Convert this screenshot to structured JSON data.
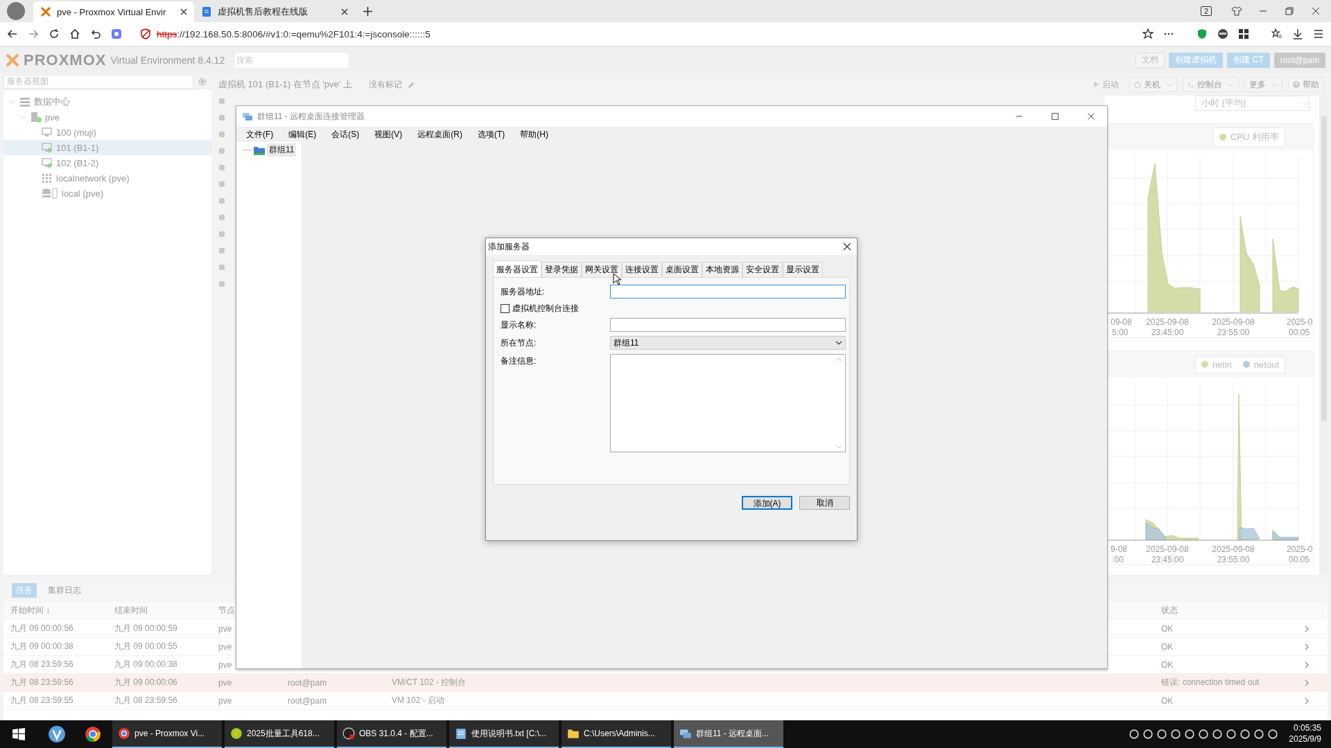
{
  "browser": {
    "tabs": [
      {
        "title": "pve - Proxmox Virtual Envir",
        "kind": "proxmox",
        "selected": true
      },
      {
        "title": "虚拟机售后教程在线版",
        "kind": "doc",
        "selected": false
      }
    ],
    "tab_count": "2",
    "url": {
      "scheme": "https",
      "rest": "://192.168.50.5:8006/#v1:0:=qemu%2F101:4:=jsconsole::::::5",
      "insecure": true
    }
  },
  "pve": {
    "logo": "PROXMOX",
    "product": "Virtual Environment 8.4.12",
    "search_placeholder": "搜索",
    "header_buttons": [
      {
        "label": "文档",
        "kind": "plain"
      },
      {
        "label": "创建虚拟机",
        "kind": "primary"
      },
      {
        "label": "创建 CT",
        "kind": "primary"
      }
    ],
    "user": "root@pam",
    "view_select": "服务器视图",
    "tree": [
      {
        "label": "数据中心",
        "kind": "datacenter",
        "expanded": true,
        "selected": false,
        "children": [
          {
            "label": "pve",
            "kind": "node",
            "expanded": true,
            "selected": false,
            "children": [
              {
                "label": "100 (muji)",
                "kind": "vm",
                "running": false,
                "selected": false
              },
              {
                "label": "101 (B1-1)",
                "kind": "vm",
                "running": true,
                "selected": true
              },
              {
                "label": "102 (B1-2)",
                "kind": "vm",
                "running": true,
                "selected": false
              },
              {
                "label": "localnetwork (pve)",
                "kind": "network",
                "selected": false
              },
              {
                "label": "local (pve)",
                "kind": "storage",
                "selected": false
              }
            ]
          }
        ]
      }
    ],
    "title": "虚拟机 101 (B1-1) 在节点 'pve' 上",
    "tags": "没有标记",
    "toolbar": [
      {
        "label": "启动",
        "kind": "start",
        "menu": false,
        "disabled": true
      },
      {
        "label": "关机",
        "kind": "power",
        "menu": true,
        "disabled": false
      },
      {
        "label": "控制台",
        "kind": "console",
        "menu": true,
        "disabled": false
      },
      {
        "label": "更多",
        "kind": "none",
        "menu": true,
        "disabled": false
      },
      {
        "label": "帮助",
        "kind": "help",
        "menu": false,
        "disabled": false
      }
    ],
    "timeframe": "小时 (平均)",
    "charts": [
      {
        "legend": [
          {
            "label": "CPU 利用率",
            "color": "#d4dca8"
          }
        ],
        "x_labels": [
          {
            "date": "09-08",
            "time": "5:00"
          },
          {
            "date": "2025-09-08",
            "time": "23:45:00"
          },
          {
            "date": "2025-09-08",
            "time": "23:55:00"
          },
          {
            "date": "2025-0",
            "time": "00:05"
          }
        ]
      },
      {
        "legend": [
          {
            "label": "netin",
            "color": "#d4dca8"
          },
          {
            "label": "netout",
            "color": "#b3cadb"
          }
        ],
        "x_labels": [
          {
            "date": "9-08",
            "time": ":00"
          },
          {
            "date": "2025-09-08",
            "time": "23:45:00"
          },
          {
            "date": "2025-09-08",
            "time": "23:55:00"
          },
          {
            "date": "2025-0",
            "time": "00:05"
          }
        ]
      }
    ],
    "task_tabs": [
      {
        "label": "任务",
        "selected": true
      },
      {
        "label": "集群日志",
        "selected": false
      }
    ],
    "task_columns": {
      "start": "开始时间 ↓",
      "end": "结束时间",
      "node": "节点",
      "status": "状态"
    },
    "tasks": [
      {
        "start": "九月 09 00:00:56",
        "end": "九月 09 00:00:59",
        "node": "pve",
        "status": "OK",
        "error": false
      },
      {
        "start": "九月 09 00:00:38",
        "end": "九月 09 00:00:55",
        "node": "pve",
        "status": "OK",
        "error": false
      },
      {
        "start": "九月 08 23:59:56",
        "end": "九月 09 00:00:38",
        "node": "pve",
        "status": "OK",
        "error": false
      },
      {
        "start": "九月 08 23:59:56",
        "end": "九月 09 00:00:06",
        "node": "pve",
        "user": "root@pam",
        "description": "VM/CT 102 - 控制台",
        "status": "错误: connection timed out",
        "error": true
      },
      {
        "start": "九月 08 23:59:55",
        "end": "九月 08 23:59:56",
        "node": "pve",
        "user": "root@pam",
        "description": "VM 102 - 启动",
        "status": "OK",
        "error": false
      }
    ]
  },
  "rdcman": {
    "title": "群组11 - 远程桌面连接管理器",
    "menu": [
      "文件(F)",
      "编辑(E)",
      "会话(S)",
      "视图(V)",
      "远程桌面(R)",
      "选项(T)",
      "帮助(H)"
    ],
    "tree": [
      {
        "label": "群组11",
        "selected": true
      }
    ]
  },
  "dialog": {
    "title": "添加服务器",
    "tabs": [
      {
        "label": "服务器设置",
        "selected": true
      },
      {
        "label": "登录凭据",
        "selected": false
      },
      {
        "label": "网关设置",
        "selected": false
      },
      {
        "label": "连接设置",
        "selected": false
      },
      {
        "label": "桌面设置",
        "selected": false
      },
      {
        "label": "本地资源",
        "selected": false
      },
      {
        "label": "安全设置",
        "selected": false
      },
      {
        "label": "显示设置",
        "selected": false
      }
    ],
    "address_label": "服务器地址:",
    "console_label": "虚拟机控制台连接",
    "console_checked": false,
    "display_label": "显示名称:",
    "node_label": "所在节点:",
    "node_value": "群组11",
    "notes_label": "备注信息:",
    "buttons": [
      {
        "label": "添加(A)",
        "default": true
      },
      {
        "label": "取消",
        "default": false
      }
    ]
  },
  "taskbar": {
    "pinned": [
      {
        "kind": "v-app"
      },
      {
        "kind": "chrome"
      }
    ],
    "tasks": [
      {
        "label": "pve - Proxmox Vi...",
        "kind": "chrome",
        "selected": false
      },
      {
        "label": "2025批量工具618...",
        "kind": "tool",
        "selected": false
      },
      {
        "label": "OBS 31.0.4 - 配置...",
        "kind": "obs",
        "selected": false
      },
      {
        "label": "使用说明书.txt [C:\\...",
        "kind": "notepad",
        "selected": false
      },
      {
        "label": "C:\\Users\\Adminis...",
        "kind": "folder",
        "selected": false
      },
      {
        "label": "群组11 - 远程桌面...",
        "kind": "rdc",
        "selected": true
      }
    ],
    "time": "0:05:35",
    "date": "2025/9/9"
  }
}
